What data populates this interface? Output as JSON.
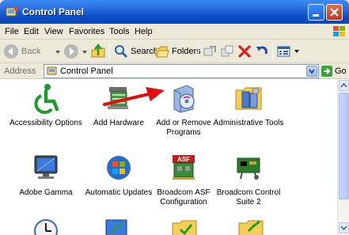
{
  "window": {
    "title": "Control Panel"
  },
  "menu": [
    "File",
    "Edit",
    "View",
    "Favorites",
    "Tools",
    "Help"
  ],
  "toolbar": {
    "back_label": "Back",
    "search_label": "Search",
    "folders_label": "Folders"
  },
  "address": {
    "label": "Address",
    "value": "Control Panel",
    "go_label": "Go"
  },
  "items": [
    {
      "label": "Accessibility Options",
      "icon": "accessibility-icon"
    },
    {
      "label": "Add Hardware",
      "icon": "add-hardware-icon"
    },
    {
      "label": "Add or Remove Programs",
      "icon": "add-remove-programs-icon"
    },
    {
      "label": "Administrative Tools",
      "icon": "administrative-tools-icon"
    },
    {
      "label": "Adobe Gamma",
      "icon": "adobe-gamma-icon"
    },
    {
      "label": "Automatic Updates",
      "icon": "automatic-updates-icon"
    },
    {
      "label": "Broadcom ASF Configuration",
      "icon": "broadcom-asf-icon"
    },
    {
      "label": "Broadcom Control Suite 2",
      "icon": "broadcom-control-suite-icon"
    }
  ],
  "colors": {
    "title_bar": "#0a4fc7",
    "close_button": "#c4331a",
    "highlight_arrow": "#e01010"
  }
}
